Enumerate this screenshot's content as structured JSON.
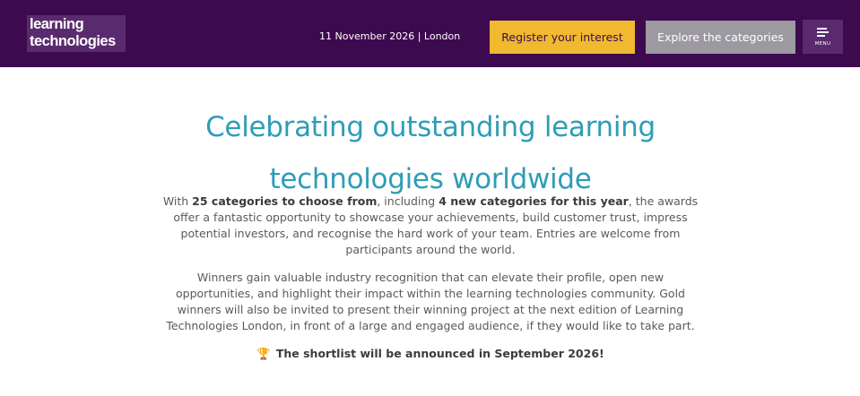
{
  "header": {
    "logo": {
      "line1": "learning",
      "line2": "technologies"
    },
    "event_info": "11 November 2026 | London",
    "register_label": "Register your interest",
    "explore_label": "Explore the categories",
    "menu_label": "MENU"
  },
  "main": {
    "headline": "Celebrating outstanding learning technologies worldwide",
    "para1": {
      "t1": "With ",
      "b1": "25 categories to choose from",
      "t2": ", including ",
      "b2": "4 new categories for this year",
      "t3": ", the awards offer a fantastic opportunity to showcase your achievements, build customer trust, impress potential investors, and recognise the hard work of your team. Entries are welcome from participants around the world."
    },
    "para2": "Winners gain valuable industry recognition that can elevate their profile, open new opportunities, and highlight their impact within the learning technologies community. Gold winners will also be invited to present their winning project at the next edition of Learning Technologies London, in front of a large and engaged audience, if they would like to take part.",
    "shortlist": "The shortlist will be announced in September 2026!"
  },
  "icons": {
    "menu": "hamburger-icon",
    "shortlist": "trophy-icon"
  },
  "colors": {
    "header_bg": "#3d0a4f",
    "register_bg": "#f0b92f",
    "explore_bg": "#9c9aa0",
    "headline": "#2e9db7"
  }
}
